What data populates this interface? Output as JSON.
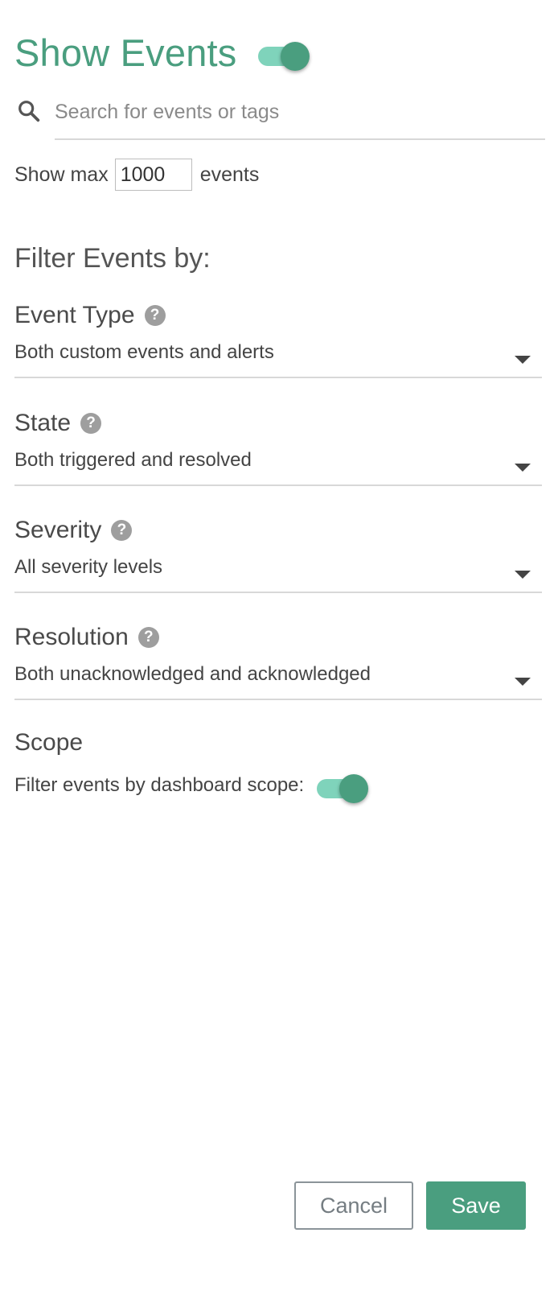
{
  "header": {
    "title": "Show Events",
    "toggle_on": true
  },
  "search": {
    "placeholder": "Search for events or tags",
    "value": ""
  },
  "show_max": {
    "prefix": "Show max",
    "value": "1000",
    "suffix": "events"
  },
  "filter": {
    "heading": "Filter Events by:",
    "fields": [
      {
        "label": "Event Type",
        "value": "Both custom events and alerts"
      },
      {
        "label": "State",
        "value": "Both triggered and resolved"
      },
      {
        "label": "Severity",
        "value": "All severity levels"
      },
      {
        "label": "Resolution",
        "value": "Both unacknowledged and acknowledged"
      }
    ],
    "help_glyph": "?"
  },
  "scope": {
    "label": "Scope",
    "toggle_text": "Filter events by dashboard scope:",
    "toggle_on": true
  },
  "actions": {
    "cancel_label": "Cancel",
    "save_label": "Save"
  },
  "colors": {
    "accent": "#4a9e7f",
    "toggle_track": "#7fd3bb",
    "help_icon": "#9e9e9e"
  }
}
